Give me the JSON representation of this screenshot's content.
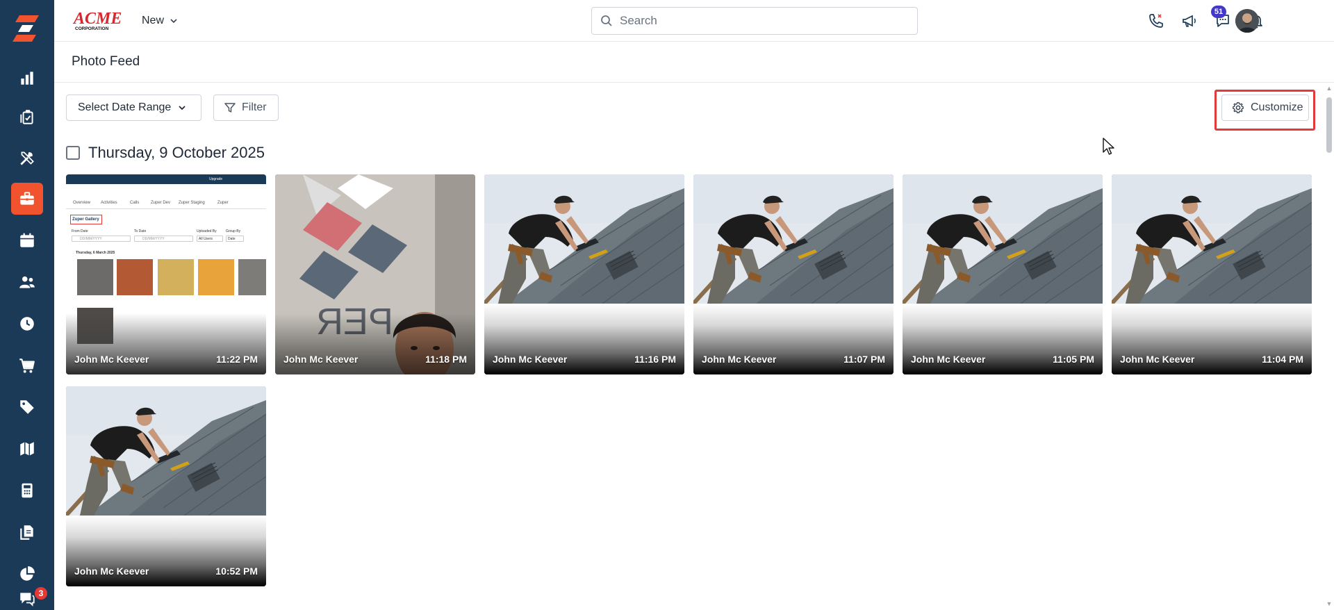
{
  "brand": {
    "logo_text": "ACME",
    "logo_subtext": "CORPORATION",
    "accent": "#f0532d",
    "sidebar_bg": "#1b3a57"
  },
  "sidebar": {
    "items": [
      {
        "icon": "bar-chart-icon",
        "name": "dashboard"
      },
      {
        "icon": "clipboard-check-icon",
        "name": "jobs"
      },
      {
        "icon": "tools-icon",
        "name": "service"
      },
      {
        "icon": "briefcase-icon",
        "name": "projects",
        "active": true
      },
      {
        "icon": "calendar-icon",
        "name": "schedule"
      },
      {
        "icon": "users-icon",
        "name": "customers"
      },
      {
        "icon": "clock-icon",
        "name": "timesheets"
      },
      {
        "icon": "cart-icon",
        "name": "purchase"
      },
      {
        "icon": "tag-icon",
        "name": "products"
      },
      {
        "icon": "map-icon",
        "name": "map"
      },
      {
        "icon": "calculator-icon",
        "name": "invoices"
      },
      {
        "icon": "documents-icon",
        "name": "documents"
      },
      {
        "icon": "pie-chart-icon",
        "name": "reports"
      },
      {
        "icon": "chat-icon",
        "name": "chat"
      }
    ],
    "chat_badge": "3"
  },
  "header": {
    "new_label": "New",
    "search_placeholder": "Search",
    "notification_count": "51"
  },
  "page": {
    "title": "Photo Feed"
  },
  "toolbar": {
    "date_range_label": "Select Date Range",
    "filter_label": "Filter",
    "customize_label": "Customize"
  },
  "feed": {
    "date_heading": "Thursday, 9 October 2025",
    "photos": [
      {
        "author": "John Mc Keever",
        "time": "11:22 PM",
        "kind": "screenshot"
      },
      {
        "author": "John Mc Keever",
        "time": "11:18 PM",
        "kind": "selfie"
      },
      {
        "author": "John Mc Keever",
        "time": "11:16 PM",
        "kind": "roofer"
      },
      {
        "author": "John Mc Keever",
        "time": "11:07 PM",
        "kind": "roofer"
      },
      {
        "author": "John Mc Keever",
        "time": "11:05 PM",
        "kind": "roofer"
      },
      {
        "author": "John Mc Keever",
        "time": "11:04 PM",
        "kind": "roofer"
      },
      {
        "author": "John Mc Keever",
        "time": "10:52 PM",
        "kind": "roofer"
      }
    ]
  },
  "screenshot_thumb": {
    "tabs": [
      "Overview",
      "Activities",
      "Calls",
      "Zuper Dev",
      "Zuper Staging",
      "Zuper"
    ],
    "gallery_label": "Zuper Gallery",
    "from_label": "From Date",
    "to_label": "To Date",
    "uploaded_label": "Uploaded By",
    "group_label": "Group By",
    "from_placeholder": "DD/MM/YYYY",
    "to_placeholder": "DD/MM/YYYY",
    "uploaded_value": "All Users",
    "group_value": "Date",
    "date_heading": "Thursday, 6 March 2025",
    "upgrade_label": "Upgrade"
  },
  "selfie_sign_text": "PER"
}
